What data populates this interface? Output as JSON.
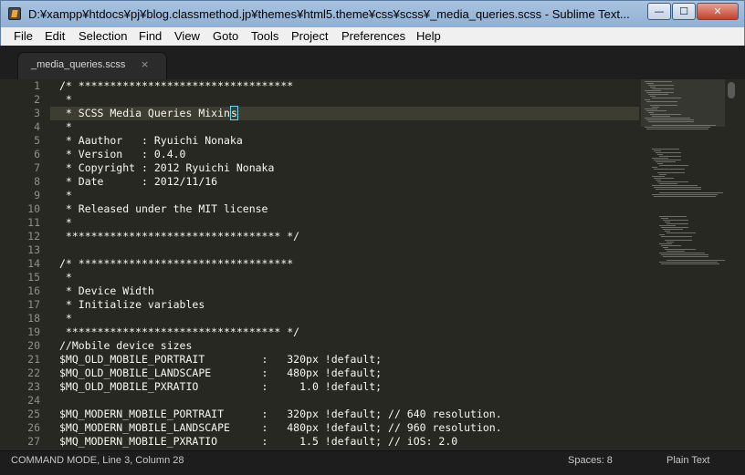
{
  "window": {
    "title": "D:¥xampp¥htdocs¥pj¥blog.classmethod.jp¥themes¥html5.theme¥css¥scss¥_media_queries.scss - Sublime Text...",
    "min_label": "—",
    "max_label": "☐",
    "close_label": "✕"
  },
  "menu": [
    "File",
    "Edit",
    "Selection",
    "Find",
    "View",
    "Goto",
    "Tools",
    "Project",
    "Preferences",
    "Help"
  ],
  "tab": {
    "label": "_media_queries.scss",
    "close": "×"
  },
  "editor": {
    "current_line": 3,
    "lines": [
      {
        "num": "1",
        "text": "/* **********************************"
      },
      {
        "num": "2",
        "text": " *"
      },
      {
        "num": "3",
        "text": " * SCSS Media Queries Mixin",
        "cursor": "s"
      },
      {
        "num": "4",
        "text": " *"
      },
      {
        "num": "5",
        "text": " * Aauthor   : Ryuichi Nonaka"
      },
      {
        "num": "6",
        "text": " * Version   : 0.4.0"
      },
      {
        "num": "7",
        "text": " * Copyright : 2012 Ryuichi Nonaka"
      },
      {
        "num": "8",
        "text": " * Date      : 2012/11/16"
      },
      {
        "num": "9",
        "text": " *"
      },
      {
        "num": "10",
        "text": " * Released under the MIT license"
      },
      {
        "num": "11",
        "text": " *"
      },
      {
        "num": "12",
        "text": " ********************************** */"
      },
      {
        "num": "13",
        "text": ""
      },
      {
        "num": "14",
        "text": "/* **********************************"
      },
      {
        "num": "15",
        "text": " *"
      },
      {
        "num": "16",
        "text": " * Device Width"
      },
      {
        "num": "17",
        "text": " * Initialize variables"
      },
      {
        "num": "18",
        "text": " *"
      },
      {
        "num": "19",
        "text": " ********************************** */"
      },
      {
        "num": "20",
        "text": "//Mobile device sizes"
      },
      {
        "num": "21",
        "text": "$MQ_OLD_MOBILE_PORTRAIT         :   320px !default;"
      },
      {
        "num": "22",
        "text": "$MQ_OLD_MOBILE_LANDSCAPE        :   480px !default;"
      },
      {
        "num": "23",
        "text": "$MQ_OLD_MOBILE_PXRATIO          :     1.0 !default;"
      },
      {
        "num": "24",
        "text": ""
      },
      {
        "num": "25",
        "text": "$MQ_MODERN_MOBILE_PORTRAIT      :   320px !default; // 640 resolution."
      },
      {
        "num": "26",
        "text": "$MQ_MODERN_MOBILE_LANDSCAPE     :   480px !default; // 960 resolution."
      },
      {
        "num": "27",
        "text": "$MQ_MODERN_MOBILE_PXRATIO       :     1.5 !default; // iOS: 2.0"
      }
    ]
  },
  "status": {
    "mode": "COMMAND MODE, Line 3, Column 28",
    "spaces": "Spaces: 8",
    "syntax": "Plain Text"
  }
}
